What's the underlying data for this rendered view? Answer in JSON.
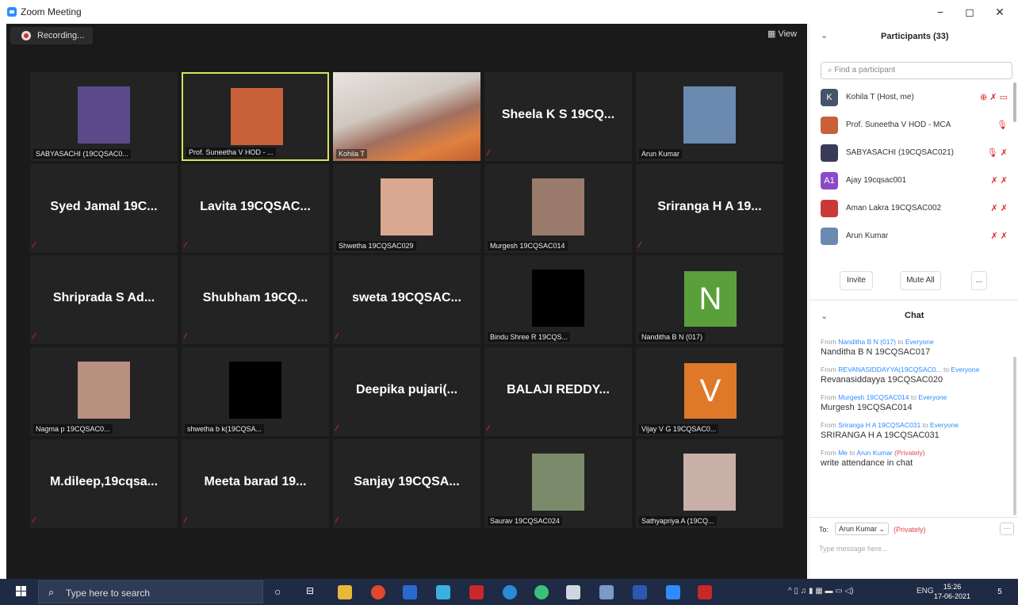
{
  "window": {
    "title": "Zoom Meeting",
    "controls": [
      "−",
      "◻",
      "✕"
    ]
  },
  "recording": {
    "label": "Recording..."
  },
  "view_button": {
    "label": "View"
  },
  "tiles": [
    {
      "name": "SABYASACHI (19CQSAC0...",
      "big": "",
      "photo": "#5a4a8a",
      "active": false
    },
    {
      "name": "Prof. Suneetha V HOD - ...",
      "big": "",
      "photo": "#c8603a",
      "active": true
    },
    {
      "name": "Kohila T",
      "big": "",
      "photo": "video",
      "active": false
    },
    {
      "name": "",
      "big": "Sheela K S 19CQ...",
      "photo": "",
      "active": false
    },
    {
      "name": "Arun Kumar",
      "big": "",
      "photo": "#6a8ab0",
      "active": false
    },
    {
      "name": "",
      "big": "Syed Jamal 19C...",
      "photo": "",
      "active": false
    },
    {
      "name": "",
      "big": "Lavita 19CQSAC...",
      "photo": "",
      "active": false
    },
    {
      "name": "Shwetha 19CQSAC029",
      "big": "",
      "photo": "#d8a890",
      "active": false
    },
    {
      "name": "Murgesh 19CQSAC014",
      "big": "",
      "photo": "#9a7a6a",
      "active": false
    },
    {
      "name": "",
      "big": "Sriranga H A 19...",
      "photo": "",
      "active": false
    },
    {
      "name": "",
      "big": "Shripradа S Ad...",
      "photo": "",
      "active": false
    },
    {
      "name": "",
      "big": "Shubham 19CQ...",
      "photo": "",
      "active": false
    },
    {
      "name": "",
      "big": "sweta 19CQSAC...",
      "photo": "",
      "active": false
    },
    {
      "name": "Bindu Shree R 19CQS...",
      "big": "",
      "photo": "#000000",
      "active": false
    },
    {
      "name": "Nanditha B N (017)",
      "big": "",
      "photo": "N",
      "active": false
    },
    {
      "name": "Nagma p 19CQSAC0...",
      "big": "",
      "photo": "#b89080",
      "active": false
    },
    {
      "name": "shwetha b k(19CQSA...",
      "big": "",
      "photo": "#000000",
      "active": false
    },
    {
      "name": "",
      "big": "Deepika pujari(...",
      "photo": "",
      "active": false
    },
    {
      "name": "",
      "big": "BALAJI REDDY...",
      "photo": "",
      "active": false
    },
    {
      "name": "Vijay V G 19CQSAC0...",
      "big": "",
      "photo": "V",
      "active": false
    },
    {
      "name": "",
      "big": "M.dileep,19cqsa...",
      "photo": "",
      "active": false
    },
    {
      "name": "",
      "big": "Meeta barad 19...",
      "photo": "",
      "active": false
    },
    {
      "name": "",
      "big": "Sanjay 19CQSA...",
      "photo": "",
      "active": false
    },
    {
      "name": "Saurav 19CQSAC024",
      "big": "",
      "photo": "#7a8a6a",
      "active": false
    },
    {
      "name": "Sathyapriya A (19CQ...",
      "big": "",
      "photo": "#c8b0a8",
      "active": false
    }
  ],
  "participants": {
    "title": "Participants (33)",
    "search_placeholder": "Find a participant",
    "list": [
      {
        "name": "Kohila T (Host, me)",
        "avatar": "K",
        "color": "#44546a",
        "icons": "⊕ ✗ ▭"
      },
      {
        "name": "Prof. Suneetha V HOD - MCA",
        "avatar": "",
        "color": "#c8603a",
        "icons": "🎙"
      },
      {
        "name": "SABYASACHI (19CQSAC021)",
        "avatar": "",
        "color": "#3a3a5a",
        "icons": "🎙 ✗"
      },
      {
        "name": "Ajay 19cqsac001",
        "avatar": "A1",
        "color": "#8a4ac8",
        "icons": "✗ ✗"
      },
      {
        "name": "Aman Lakra 19CQSAC002",
        "avatar": "",
        "color": "#c83a3a",
        "icons": "✗ ✗"
      },
      {
        "name": "Arun Kumar",
        "avatar": "",
        "color": "#6a8ab0",
        "icons": "✗ ✗"
      }
    ],
    "invite": "Invite",
    "mute_all": "Mute All",
    "more": "..."
  },
  "chat": {
    "title": "Chat",
    "messages": [
      {
        "from": "Nanditha B N (017)",
        "to": "Everyone",
        "private": "",
        "text": "Nanditha B N 19CQSAC017"
      },
      {
        "from": "REVANASIDDAYYA(19CQSAC0...",
        "to": "Everyone",
        "private": "",
        "text": "Revanasiddayya 19CQSAC020"
      },
      {
        "from": "Murgesh 19CQSAC014",
        "to": "Everyone",
        "private": "",
        "text": "Murgesh 19CQSAC014"
      },
      {
        "from": "Sriranga H A 19CQSAC031",
        "to": "Everyone",
        "private": "",
        "text": "SRIRANGA H A 19CQSAC031"
      },
      {
        "from": "Me",
        "to": "Arun Kumar",
        "private": "(Privately)",
        "text": "write attendance in chat"
      }
    ],
    "from_word": "From",
    "to_word": "to",
    "to_label": "To:",
    "to_value": "Arun Kumar",
    "to_private": "(Privately)",
    "more": "···",
    "placeholder": "Type message here..."
  },
  "taskbar": {
    "search_placeholder": "Type here to search",
    "lang": "ENG",
    "time": "15:26",
    "date": "17-06-2021",
    "notif_count": "5"
  }
}
